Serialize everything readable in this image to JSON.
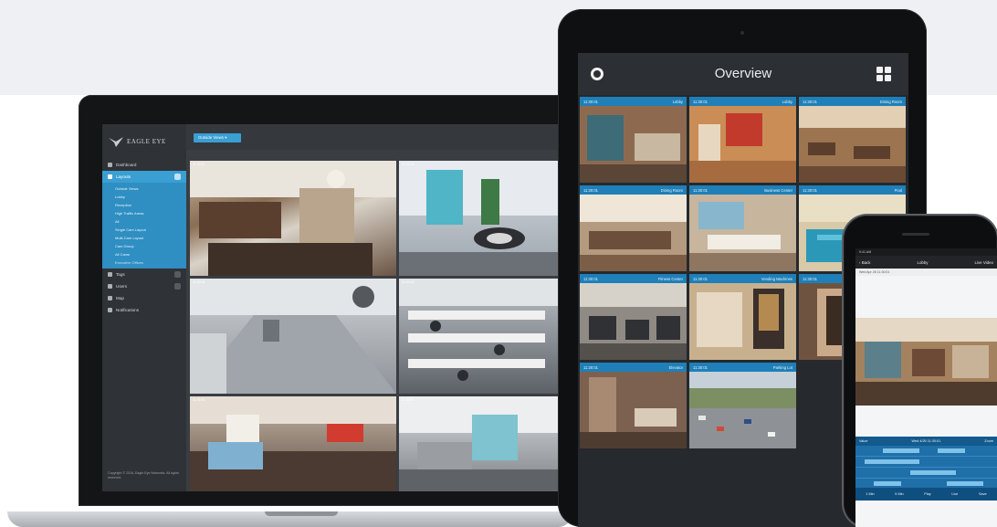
{
  "laptop": {
    "logo_text": "EAGLE EYE",
    "layout_button": "Outside Views",
    "nav": [
      {
        "label": "Dashboard",
        "icon": "dashboard-icon"
      },
      {
        "label": "Layouts",
        "icon": "layouts-icon",
        "active": true
      },
      {
        "label": "Tags",
        "icon": "tag-icon"
      },
      {
        "label": "Users",
        "icon": "users-icon"
      },
      {
        "label": "Map",
        "icon": "map-icon"
      },
      {
        "label": "Notifications",
        "icon": "bell-icon"
      }
    ],
    "layouts": [
      "Outside Views",
      "Lobby",
      "Reception",
      "High Traffic Areas",
      "All",
      "Single Cam Layout",
      "Multi-Cam Layout",
      "Cam Group",
      "All Cams",
      "Executive Offices"
    ],
    "footer": "Copyright © 2016, Eagle Eye Networks. All rights reserved.",
    "cams": [
      {
        "stamp": "11:30:01",
        "scene": "cafe"
      },
      {
        "stamp": "11:30:01",
        "scene": "atrium"
      },
      {
        "stamp": "11:30:01",
        "scene": "hallway"
      },
      {
        "stamp": "11:30:01",
        "scene": "office"
      },
      {
        "stamp": "11:30:01",
        "scene": "lounge"
      },
      {
        "stamp": "11:30:01",
        "scene": "desk"
      }
    ]
  },
  "tablet": {
    "title": "Overview",
    "tiles": [
      {
        "time": "11:30:01",
        "name": "Lobby",
        "scene": "lobby"
      },
      {
        "time": "11:30:01",
        "name": "Lobby",
        "scene": "reception"
      },
      {
        "time": "11:30:01",
        "name": "Dining Room",
        "scene": "dining"
      },
      {
        "time": "11:30:01",
        "name": "Dining Room",
        "scene": "diningroom"
      },
      {
        "time": "11:30:01",
        "name": "Business Center",
        "scene": "business"
      },
      {
        "time": "11:30:01",
        "name": "Pool",
        "scene": "pool"
      },
      {
        "time": "11:30:01",
        "name": "Fitness Center",
        "scene": "fitness"
      },
      {
        "time": "11:30:01",
        "name": "Vending Machines",
        "scene": "vending"
      },
      {
        "time": "11:30:01",
        "name": "",
        "scene": "door"
      },
      {
        "time": "11:30:01",
        "name": "Elevator",
        "scene": "elevator"
      },
      {
        "time": "11:30:01",
        "name": "Parking Lot",
        "scene": "parking"
      }
    ]
  },
  "phone": {
    "status": "9:41 AM",
    "nav_back": "Back",
    "nav_title": "Lobby",
    "nav_right": "Live Video",
    "sub": "Wed Apr 26 11:30:01",
    "timeline_left": "Value",
    "timeline_mid": "Wed 4/26 11:30:01",
    "timeline_right": "Zoom",
    "controls": [
      "1 Min",
      "5 Min",
      "Play",
      "Live",
      "Save"
    ]
  }
}
